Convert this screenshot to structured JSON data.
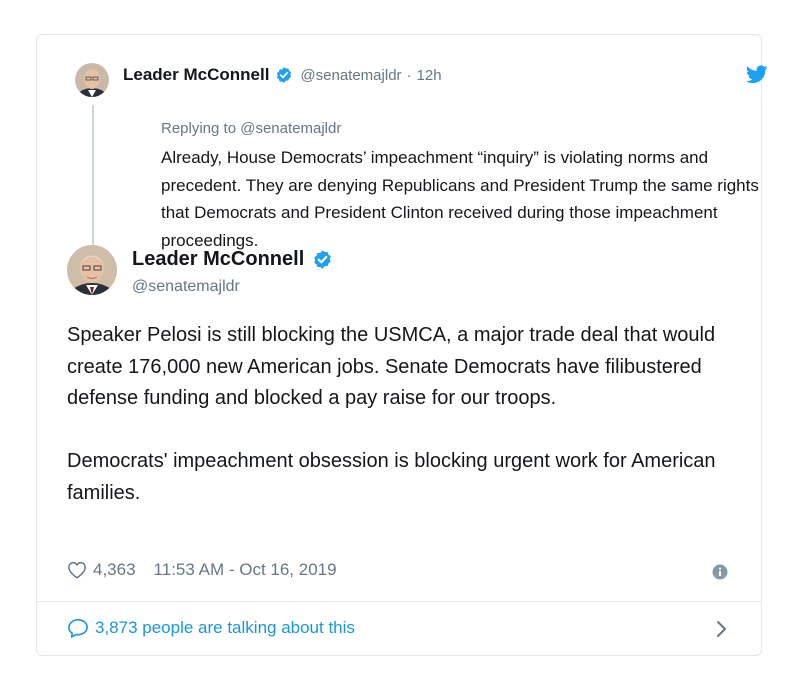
{
  "parent_tweet": {
    "name": "Leader McConnell",
    "handle": "@senatemajldr",
    "separator": "·",
    "age": "12h",
    "replying_prefix": "Replying to",
    "replying_handle": "@senatemajldr",
    "text": "Already, House Democrats’ impeachment “inquiry” is violating norms and precedent. They are denying Republicans and President Trump the same rights that Democrats and President Clinton received during those impeachment proceedings."
  },
  "main_tweet": {
    "name": "Leader McConnell",
    "handle": "@senatemajldr",
    "paragraphs": [
      "Speaker Pelosi is still blocking the USMCA, a major trade deal that would create 176,000 new American jobs. Senate Democrats have filibustered defense funding and blocked a pay raise for our troops.",
      "Democrats' impeachment obsession is blocking urgent work for American families."
    ],
    "likes": "4,363",
    "timestamp": "11:53 AM - Oct 16, 2019"
  },
  "footer": {
    "talking_text": "3,873 people are talking about this"
  },
  "icons": {
    "verified": "verified-badge-icon",
    "twitter": "twitter-bird-icon",
    "like": "heart-icon",
    "info": "info-icon",
    "conversation": "speech-bubble-icon",
    "chevron": "chevron-right-icon"
  },
  "colors": {
    "twitter_blue": "#1da1f2",
    "link_blue": "#1b95e0",
    "secondary_text": "#657786",
    "primary_text": "#14171a",
    "border": "#e1e8ed"
  }
}
